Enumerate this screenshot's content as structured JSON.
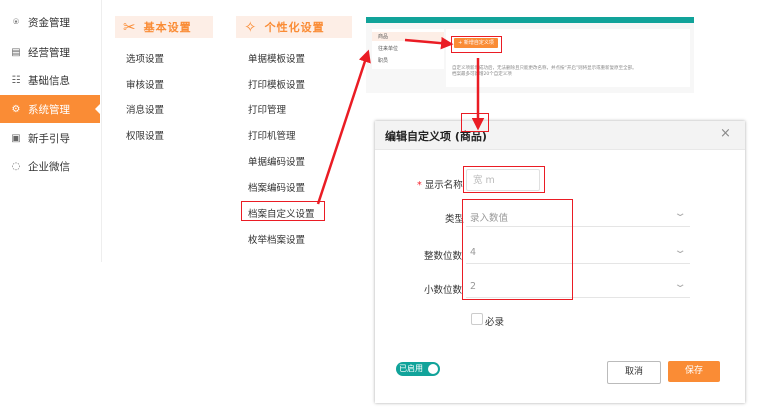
{
  "sidebar": {
    "items": [
      {
        "label": "资金管理",
        "icon": "money-bag-icon",
        "glyph": "⍟"
      },
      {
        "label": "经营管理",
        "icon": "clipboard-icon",
        "glyph": "▤"
      },
      {
        "label": "基础信息",
        "icon": "id-card-icon",
        "glyph": "☷"
      },
      {
        "label": "系统管理",
        "icon": "settings-icon",
        "glyph": "⚙"
      },
      {
        "label": "新手引导",
        "icon": "guide-book-icon",
        "glyph": "▣"
      },
      {
        "label": "企业微信",
        "icon": "chat-icon",
        "glyph": "◌"
      }
    ],
    "active_index": 3
  },
  "basic_settings": {
    "title": "基本设置",
    "icon": "tools-icon",
    "links": [
      "选项设置",
      "审核设置",
      "消息设置",
      "权限设置"
    ]
  },
  "personal_settings": {
    "title": "个性化设置",
    "icon": "star-icon",
    "links": [
      "单据模板设置",
      "打印模板设置",
      "打印管理",
      "打印机管理",
      "单据编码设置",
      "档案编码设置",
      "档案自定义设置",
      "枚举档案设置"
    ]
  },
  "thumbnail": {
    "list_items": [
      "商品",
      "往来单位",
      "职员"
    ],
    "add_button": "+ 新增自定义项",
    "note_line1": "自定义项新增成功后，无法删除且只能更改名称，并点按“开启”则将显示或重新复原至全部。",
    "note_line2": "档案最多可新增20个自定义项"
  },
  "modal": {
    "title": "编辑自定义项 (商品)",
    "close": "×",
    "fields": {
      "display_name": {
        "label": "显示名称",
        "required_mark": "*",
        "value": "宽 m"
      },
      "type": {
        "label": "类型",
        "value": "录入数值"
      },
      "integer_digits": {
        "label": "整数位数",
        "value": "4"
      },
      "decimal_digits": {
        "label": "小数位数",
        "value": "2"
      }
    },
    "required_checkbox": "必录",
    "toggle_label": "已启用",
    "cancel": "取消",
    "save": "保存"
  },
  "colors": {
    "accent": "#fa8c35",
    "teal": "#11a39a",
    "highlight": "#ea1c24"
  }
}
